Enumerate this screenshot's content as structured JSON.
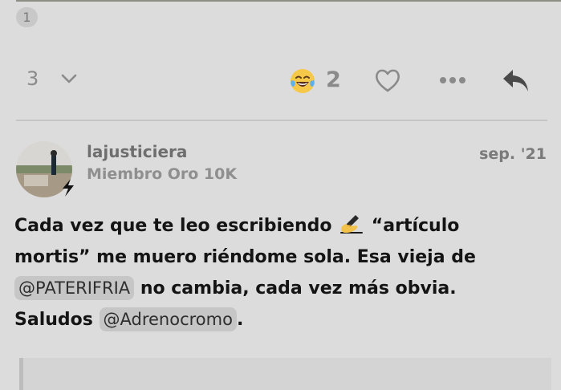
{
  "thread": {
    "previous_post_badge": "1"
  },
  "actions": {
    "replies_count": "3",
    "reaction_emoji": "joy-face-with-tears",
    "reaction_count": "2"
  },
  "post": {
    "username": "lajusticiera",
    "user_title": "Miembro Oro 10K",
    "date": "sep. '21",
    "body": {
      "line1_before_emoji": "Cada vez que te leo escribiendo ",
      "line1_emoji": "writing-hand",
      "line1_after_emoji": " “artículo",
      "line2": "mortis” me muero riéndome sola. Esa vieja de",
      "line3_mention": "@PATERIFRIA",
      "line3_after": " no cambia, cada vez más obvia.",
      "line4_before": "Saludos ",
      "line4_mention": "@Adrenocromo",
      "line4_after": "."
    }
  },
  "colors": {
    "background": "#dcdcdc",
    "mention_bg": "#c6c6c6",
    "muted_text": "#8a8a8a"
  }
}
